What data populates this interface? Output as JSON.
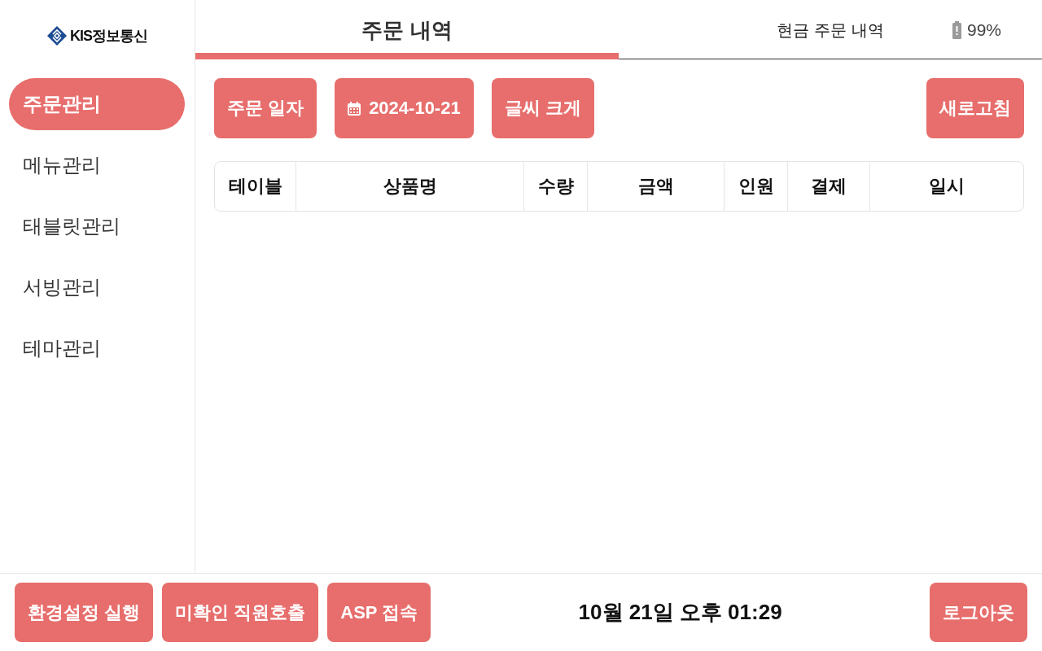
{
  "sidebar": {
    "logo": "KIS정보통신",
    "items": [
      {
        "label": "주문관리",
        "selected": true
      },
      {
        "label": "메뉴관리",
        "selected": false
      },
      {
        "label": "태블릿관리",
        "selected": false
      },
      {
        "label": "서빙관리",
        "selected": false
      },
      {
        "label": "테마관리",
        "selected": false
      }
    ]
  },
  "tabs": [
    {
      "label": "주문 내역",
      "selected": true
    },
    {
      "label": "현금 주문 내역",
      "selected": false
    }
  ],
  "status": {
    "battery": "99%"
  },
  "toolbar": {
    "buttons": [
      {
        "kind": "text",
        "label": "주문 일자"
      },
      {
        "kind": "date",
        "label": "2024-10-21"
      },
      {
        "kind": "text",
        "label": "글씨 크게"
      }
    ],
    "refresh_button": "새로고침"
  },
  "table": {
    "columns": [
      "테이블",
      "상품명",
      "수량",
      "금액",
      "인원",
      "결제",
      "일시"
    ]
  },
  "footer": {
    "buttons": [
      "환경설정 실행",
      "미확인 직원호출",
      "ASP 접속"
    ],
    "datetime": "10월 21일 오후 01:29",
    "logout_button": "로그아웃"
  }
}
